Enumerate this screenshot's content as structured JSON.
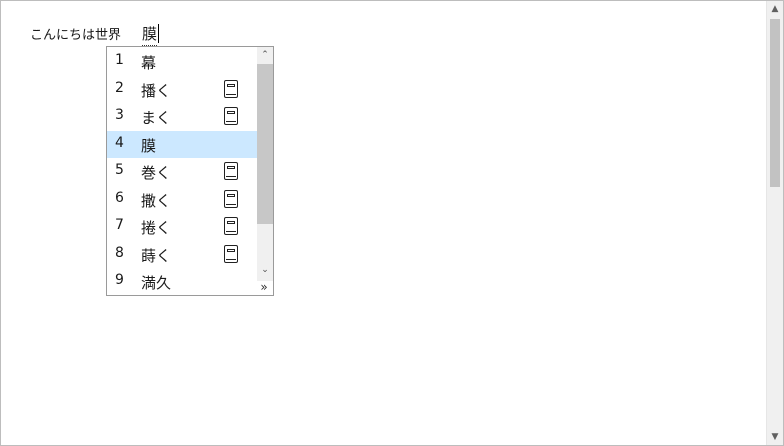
{
  "editor": {
    "text": "こんにちは世界",
    "composition": "膜"
  },
  "candidate_window": {
    "items": [
      {
        "number": "1",
        "word": "幕",
        "dict_icon": false,
        "selected": false
      },
      {
        "number": "2",
        "word": "播く",
        "dict_icon": true,
        "selected": false
      },
      {
        "number": "3",
        "word": "まく",
        "dict_icon": true,
        "selected": false
      },
      {
        "number": "4",
        "word": "膜",
        "dict_icon": false,
        "selected": true
      },
      {
        "number": "5",
        "word": "巻く",
        "dict_icon": true,
        "selected": false
      },
      {
        "number": "6",
        "word": "撒く",
        "dict_icon": true,
        "selected": false
      },
      {
        "number": "7",
        "word": "捲く",
        "dict_icon": true,
        "selected": false
      },
      {
        "number": "8",
        "word": "蒔く",
        "dict_icon": true,
        "selected": false
      },
      {
        "number": "9",
        "word": "満久",
        "dict_icon": false,
        "selected": false
      }
    ],
    "scroll_up_glyph": "⌃",
    "scroll_down_glyph": "⌄",
    "expand_glyph": "»",
    "dict_icon_name": "dictionary-icon",
    "selected_color": "#cce8ff"
  },
  "window_scrollbar": {
    "up_glyph": "▲",
    "down_glyph": "▼"
  }
}
